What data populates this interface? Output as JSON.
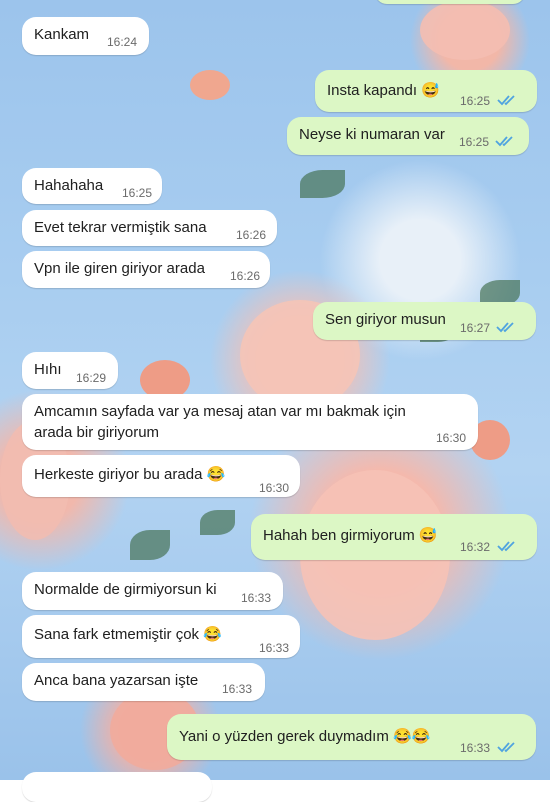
{
  "messages": [
    {
      "dir": "in",
      "text": "Kankam",
      "time": "16:24"
    },
    {
      "dir": "out",
      "text": "Insta kapandı",
      "emoji": "😅",
      "time": "16:25"
    },
    {
      "dir": "out",
      "text": "Neyse ki numaran var",
      "time": "16:25"
    },
    {
      "dir": "in",
      "text": "Hahahaha",
      "time": "16:25"
    },
    {
      "dir": "in",
      "text": "Evet tekrar vermiştik sana",
      "time": "16:26"
    },
    {
      "dir": "in",
      "text": "Vpn ile giren giriyor arada",
      "time": "16:26"
    },
    {
      "dir": "out",
      "text": "Sen giriyor musun",
      "time": "16:27"
    },
    {
      "dir": "in",
      "text": "Hıhı",
      "time": "16:29"
    },
    {
      "dir": "in",
      "text": "Amcamın sayfada var ya mesaj atan var mı bakmak için arada bir giriyorum",
      "time": "16:30"
    },
    {
      "dir": "in",
      "text": "Herkeste giriyor bu arada",
      "emoji": "😂",
      "time": "16:30"
    },
    {
      "dir": "out",
      "text": "Hahah ben girmiyorum",
      "emoji": "😅",
      "time": "16:32"
    },
    {
      "dir": "in",
      "text": "Normalde de girmiyorsun ki",
      "time": "16:33"
    },
    {
      "dir": "in",
      "text": "Sana fark etmemiştir çok",
      "emoji": "😂",
      "time": "16:33"
    },
    {
      "dir": "in",
      "text": "Anca bana yazarsan işte",
      "time": "16:33"
    },
    {
      "dir": "out",
      "text": "Yani o yüzden gerek duymadım",
      "emoji": "😂😂",
      "time": "16:33"
    }
  ],
  "colors": {
    "incoming": "#ffffff",
    "outgoing": "#dcf7c5",
    "read_ticks": "#4fa3e0"
  },
  "icons": {
    "read": "double-check-icon"
  }
}
